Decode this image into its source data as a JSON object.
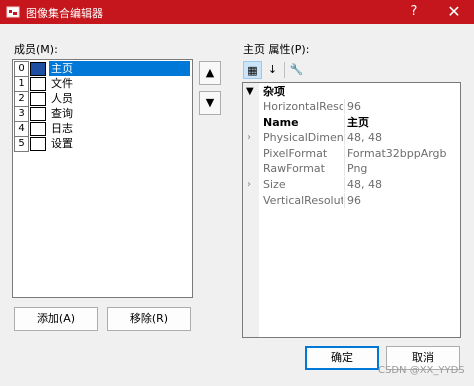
{
  "window": {
    "title": "图像集合编辑器",
    "help_label": "?",
    "close_label": "✕"
  },
  "members": {
    "label": "成员(M):",
    "items": [
      {
        "index": "0",
        "label": "主页",
        "selected": true
      },
      {
        "index": "1",
        "label": "文件",
        "selected": false
      },
      {
        "index": "2",
        "label": "人员",
        "selected": false
      },
      {
        "index": "3",
        "label": "查询",
        "selected": false
      },
      {
        "index": "4",
        "label": "日志",
        "selected": false
      },
      {
        "index": "5",
        "label": "设置",
        "selected": false
      }
    ],
    "move_up_label": "▲",
    "move_down_label": "▼",
    "add_label": "添加(A)",
    "remove_label": "移除(R)"
  },
  "properties": {
    "label": "主页 属性(P):",
    "toolbar": {
      "categorized_label": "▦",
      "alphabetical_label": "↓",
      "property_pages_label": "🔧"
    },
    "category": "杂项",
    "rows": [
      {
        "name": "HorizontalResolu",
        "value": "96",
        "expandable": false,
        "bold": false
      },
      {
        "name": "Name",
        "value": "主页",
        "expandable": false,
        "bold": true
      },
      {
        "name": "PhysicalDimensic",
        "value": "48, 48",
        "expandable": true,
        "bold": false
      },
      {
        "name": "PixelFormat",
        "value": "Format32bppArgb",
        "expandable": false,
        "bold": false
      },
      {
        "name": "RawFormat",
        "value": "Png",
        "expandable": false,
        "bold": false
      },
      {
        "name": "Size",
        "value": "48, 48",
        "expandable": true,
        "bold": false
      },
      {
        "name": "VerticalResolutio",
        "value": "96",
        "expandable": false,
        "bold": false
      }
    ]
  },
  "footer": {
    "ok_label": "确定",
    "cancel_label": "取消"
  },
  "watermark": "CSDN @XX_YYDS",
  "colors": {
    "titlebar": "#c4161c",
    "selection": "#0078d7"
  }
}
